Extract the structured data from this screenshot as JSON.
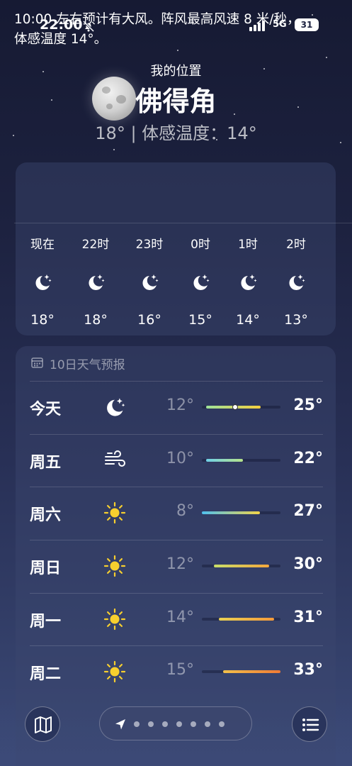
{
  "status_bar": {
    "time": "22:00",
    "network": "5G",
    "battery": "31"
  },
  "location": {
    "label": "我的位置",
    "city": "佛得角",
    "current": "18° | 体感温度：14°"
  },
  "alert_text": "10:00 左右预计有大风。阵风最高风速 8 米/秒，体感温度 14°。",
  "hourly": [
    {
      "label": "现在",
      "icon": "moon-stars-icon",
      "temp": "18°"
    },
    {
      "label": "22时",
      "icon": "moon-stars-icon",
      "temp": "18°"
    },
    {
      "label": "23时",
      "icon": "moon-stars-icon",
      "temp": "16°"
    },
    {
      "label": "0时",
      "icon": "moon-stars-icon",
      "temp": "15°"
    },
    {
      "label": "1时",
      "icon": "moon-stars-icon",
      "temp": "14°"
    },
    {
      "label": "2时",
      "icon": "moon-stars-icon",
      "temp": "13°"
    }
  ],
  "daily_title": "10日天气预报",
  "daily": [
    {
      "day": "今天",
      "icon": "moon-stars-icon",
      "low": "12°",
      "high": "25°",
      "bar_from": 0.05,
      "bar_to": 0.75,
      "current_marker": 0.42,
      "colors": [
        "#9ee29a",
        "#f5cf3e"
      ]
    },
    {
      "day": "周五",
      "icon": "wind-icon",
      "low": "10°",
      "high": "22°",
      "bar_from": 0.05,
      "bar_to": 0.52,
      "colors": [
        "#6fd0e8",
        "#b6e38a"
      ]
    },
    {
      "day": "周六",
      "icon": "sun-icon",
      "low": "8°",
      "high": "27°",
      "bar_from": 0.0,
      "bar_to": 0.74,
      "colors": [
        "#4fc0ee",
        "#f2d448"
      ]
    },
    {
      "day": "周日",
      "icon": "sun-icon",
      "low": "12°",
      "high": "30°",
      "bar_from": 0.15,
      "bar_to": 0.86,
      "colors": [
        "#c9df6a",
        "#f5a73c"
      ]
    },
    {
      "day": "周一",
      "icon": "sun-icon",
      "low": "14°",
      "high": "31°",
      "bar_from": 0.22,
      "bar_to": 0.92,
      "colors": [
        "#e9d153",
        "#f59a3a"
      ]
    },
    {
      "day": "周二",
      "icon": "sun-icon",
      "low": "15°",
      "high": "33°",
      "bar_from": 0.27,
      "bar_to": 1.0,
      "colors": [
        "#f2c14a",
        "#f07a35"
      ]
    }
  ],
  "pager": {
    "pages": 8,
    "active": 0
  },
  "bottom_buttons": {
    "map": "map-icon",
    "list": "list-icon"
  }
}
